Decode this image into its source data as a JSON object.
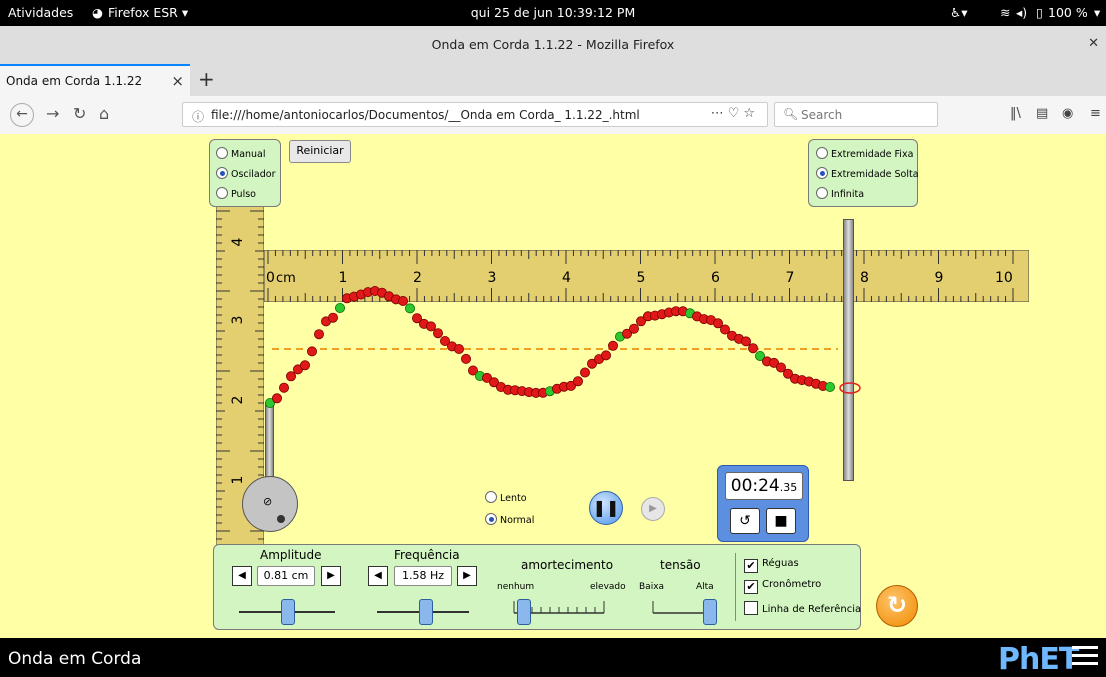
{
  "topbar": {
    "activities": "Atividades",
    "app_menu": "Firefox ESR ▾",
    "clock": "qui 25 de jun  10:39:12 PM",
    "battery": "100 %"
  },
  "window": {
    "title": "Onda em Corda 1.1.22 - Mozilla Firefox"
  },
  "tab": {
    "label": "Onda em Corda 1.1.22"
  },
  "navbar": {
    "url": "file:///home/antoniocarlos/Documentos/__Onda em Corda_ 1.1.22_.html",
    "search_placeholder": "Search"
  },
  "sim": {
    "mode_options": [
      "Manual",
      "Oscilador",
      "Pulso"
    ],
    "mode_selected": "Oscilador",
    "reset_label": "Reiniciar",
    "end_options": [
      "Extremidade Fixa",
      "Extremidade Solta",
      "Infinita"
    ],
    "end_selected": "Extremidade Solta",
    "speed_options": [
      "Lento",
      "Normal"
    ],
    "speed_selected": "Normal",
    "horizontal_ruler": {
      "unit": "cm",
      "ticks": [
        "0",
        "1",
        "2",
        "3",
        "4",
        "5",
        "6",
        "7",
        "8",
        "9",
        "10"
      ]
    },
    "vertical_ruler": {
      "ticks": [
        "4",
        "3",
        "2",
        "1"
      ]
    },
    "timer": {
      "main": "00:24",
      "fraction": ".35"
    },
    "amplitude": {
      "title": "Amplitude",
      "value": "0.81 cm",
      "level": 0.5
    },
    "frequency": {
      "title": "Frequência",
      "value": "1.58 Hz",
      "level": 0.52
    },
    "damping": {
      "title": "amortecimento",
      "min_label": "nenhum",
      "max_label": "elevado",
      "level": 0.1
    },
    "tension": {
      "title": "tensão",
      "min_label": "Baixa",
      "max_label": "Alta",
      "level": 1.0
    },
    "checkboxes": [
      {
        "label": "Réguas",
        "checked": true
      },
      {
        "label": "Cronômetro",
        "checked": true
      },
      {
        "label": "Linha de Referência",
        "checked": false
      }
    ]
  },
  "footer": {
    "title": "Onda em Corda",
    "logo": "PhET"
  }
}
